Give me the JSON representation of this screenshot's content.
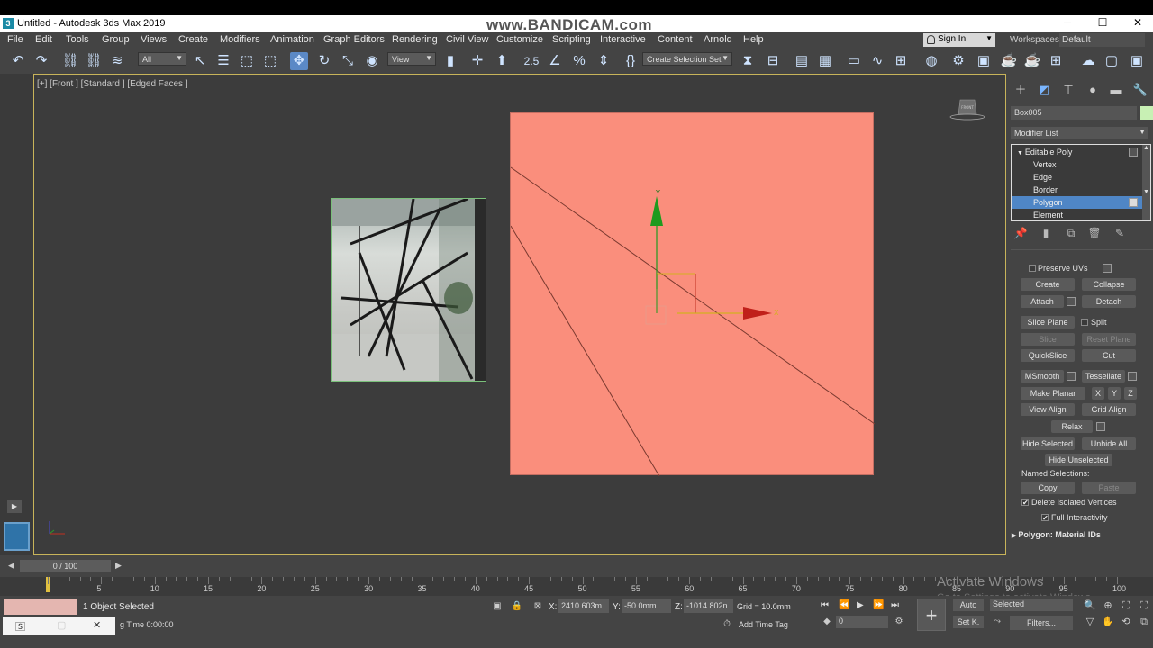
{
  "window": {
    "title": "Untitled - Autodesk 3ds Max 2019",
    "watermark": "www.BANDICAM.com",
    "minimize": "─",
    "maximize": "☐",
    "close": "✕"
  },
  "menu": {
    "items": [
      "File",
      "Edit",
      "Tools",
      "Group",
      "Views",
      "Create",
      "Modifiers",
      "Animation",
      "Graph Editors",
      "Rendering",
      "Civil View",
      "Customize",
      "Scripting",
      "Interactive",
      "Content",
      "Arnold",
      "Help"
    ],
    "sign_in": "Sign In",
    "workspaces_label": "Workspaces:",
    "workspaces_value": "Default"
  },
  "toolbar": {
    "filter_value": "All",
    "ref_coord": "View",
    "named_selection": "Create Selection Set",
    "snap_label": "2.5"
  },
  "viewport": {
    "label": "[+] [Front ] [Standard ] [Edged Faces ]",
    "gizmo_y": "Y",
    "gizmo_x": "X",
    "viewcube_label": "FRONT"
  },
  "command_panel": {
    "object_name": "Box005",
    "object_color": "#c8f0b4",
    "modifier_list": "Modifier List",
    "stack": [
      "Editable Poly",
      "Vertex",
      "Edge",
      "Border",
      "Polygon",
      "Element"
    ],
    "stack_selected": "Polygon",
    "preserve_uvs": "Preserve UVs",
    "create": "Create",
    "collapse": "Collapse",
    "attach": "Attach",
    "detach": "Detach",
    "slice_plane": "Slice Plane",
    "split": "Split",
    "slice": "Slice",
    "reset_plane": "Reset Plane",
    "quickslice": "QuickSlice",
    "cut": "Cut",
    "msmooth": "MSmooth",
    "tessellate": "Tessellate",
    "make_planar": "Make Planar",
    "x": "X",
    "y": "Y",
    "z": "Z",
    "view_align": "View Align",
    "grid_align": "Grid Align",
    "relax": "Relax",
    "hide_selected": "Hide Selected",
    "unhide_all": "Unhide All",
    "hide_unselected": "Hide Unselected",
    "named_selections": "Named Selections:",
    "copy": "Copy",
    "paste": "Paste",
    "delete_isolated": "Delete Isolated Vertices",
    "full_interactivity": "Full Interactivity",
    "material_ids": "Polygon: Material IDs"
  },
  "timeline": {
    "frame_display": "0 / 100",
    "ticks": [
      "0",
      "5",
      "10",
      "15",
      "20",
      "25",
      "30",
      "35",
      "40",
      "45",
      "50",
      "55",
      "60",
      "65",
      "70",
      "75",
      "80",
      "85",
      "90",
      "95",
      "100"
    ]
  },
  "activate_windows": {
    "title": "Activate Windows",
    "subtitle": "Go to Settings to activate Windows."
  },
  "status": {
    "selection": "1 Object Selected",
    "time_prefix": "g Time",
    "time_value": "0:00:00",
    "x_label": "X:",
    "x_value": "2410.603m",
    "y_label": "Y:",
    "y_value": "-50.0mm",
    "z_label": "Z:",
    "z_value": "-1014.802n",
    "grid": "Grid = 10.0mm",
    "add_time_tag": "Add Time Tag",
    "frame_value": "0",
    "auto": "Auto",
    "set_k": "Set K.",
    "selected": "Selected",
    "filters": "Filters..."
  }
}
